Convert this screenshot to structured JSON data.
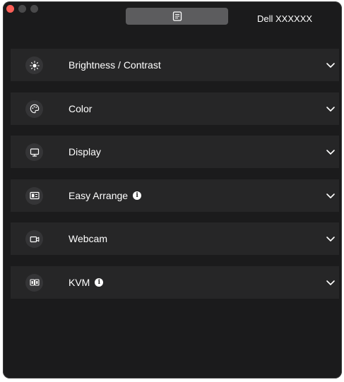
{
  "window": {
    "traffic_lights": [
      {
        "name": "close",
        "color": "#ff5f57"
      },
      {
        "name": "minimize",
        "color": "#4a4a4b"
      },
      {
        "name": "zoom",
        "color": "#4a4a4b"
      }
    ]
  },
  "header": {
    "tab_icon": "document-list-icon",
    "monitor_name": "Dell XXXXXX"
  },
  "sections": [
    {
      "id": "brightness",
      "label": "Brightness / Contrast",
      "icon": "brightness-icon",
      "info": false
    },
    {
      "id": "color",
      "label": "Color",
      "icon": "palette-icon",
      "info": false
    },
    {
      "id": "display",
      "label": "Display",
      "icon": "monitor-icon",
      "info": false
    },
    {
      "id": "easy-arrange",
      "label": "Easy Arrange",
      "icon": "layout-icon",
      "info": true
    },
    {
      "id": "webcam",
      "label": "Webcam",
      "icon": "webcam-icon",
      "info": false
    },
    {
      "id": "kvm",
      "label": "KVM",
      "icon": "kvm-icon",
      "info": true
    }
  ],
  "colors": {
    "window_bg": "#1b1b1c",
    "row_bg": "#262627",
    "icon_circle": "#353537",
    "tab_bg": "#5c5c5e",
    "text": "#ffffff"
  }
}
